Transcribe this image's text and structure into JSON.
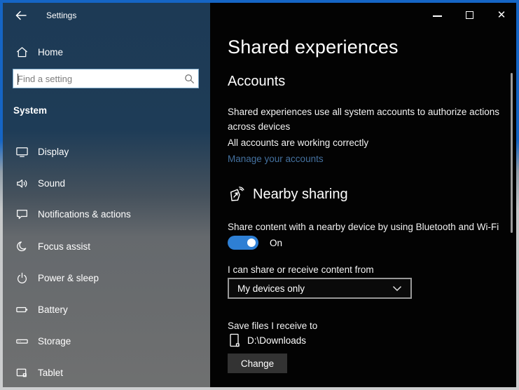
{
  "window": {
    "app_title": "Settings",
    "controls": {
      "close_glyph": "✕"
    }
  },
  "sidebar": {
    "back_label": "Settings",
    "home_label": "Home",
    "search": {
      "placeholder": "Find a setting"
    },
    "section_header": "System",
    "items": [
      {
        "icon": "display-icon",
        "label": "Display"
      },
      {
        "icon": "sound-icon",
        "label": "Sound"
      },
      {
        "icon": "notifications-icon",
        "label": "Notifications & actions"
      },
      {
        "icon": "focus-assist-icon",
        "label": "Focus assist"
      },
      {
        "icon": "power-sleep-icon",
        "label": "Power & sleep"
      },
      {
        "icon": "battery-icon",
        "label": "Battery"
      },
      {
        "icon": "storage-icon",
        "label": "Storage"
      },
      {
        "icon": "tablet-icon",
        "label": "Tablet"
      }
    ]
  },
  "main": {
    "page_title": "Shared experiences",
    "accounts": {
      "heading": "Accounts",
      "description": "Shared experiences use all system accounts to authorize actions across devices",
      "status": "All accounts are working correctly",
      "manage_link": "Manage your accounts"
    },
    "nearby_sharing": {
      "heading": "Nearby sharing",
      "description": "Share content with a nearby device by using Bluetooth and Wi-Fi",
      "toggle_state": "On",
      "share_from_label": "I can share or receive content from",
      "dropdown_value": "My devices only",
      "save_files_label": "Save files I receive to",
      "save_path": "D:\\Downloads",
      "change_button_label": "Change"
    }
  },
  "colors": {
    "frame_accent": "#1565c5",
    "sidebar_top": "#1d3a55",
    "sidebar_bottom": "#6f7070",
    "content_bg": "#030303",
    "toggle_on": "#2e7fd4",
    "link": "#44719f"
  }
}
